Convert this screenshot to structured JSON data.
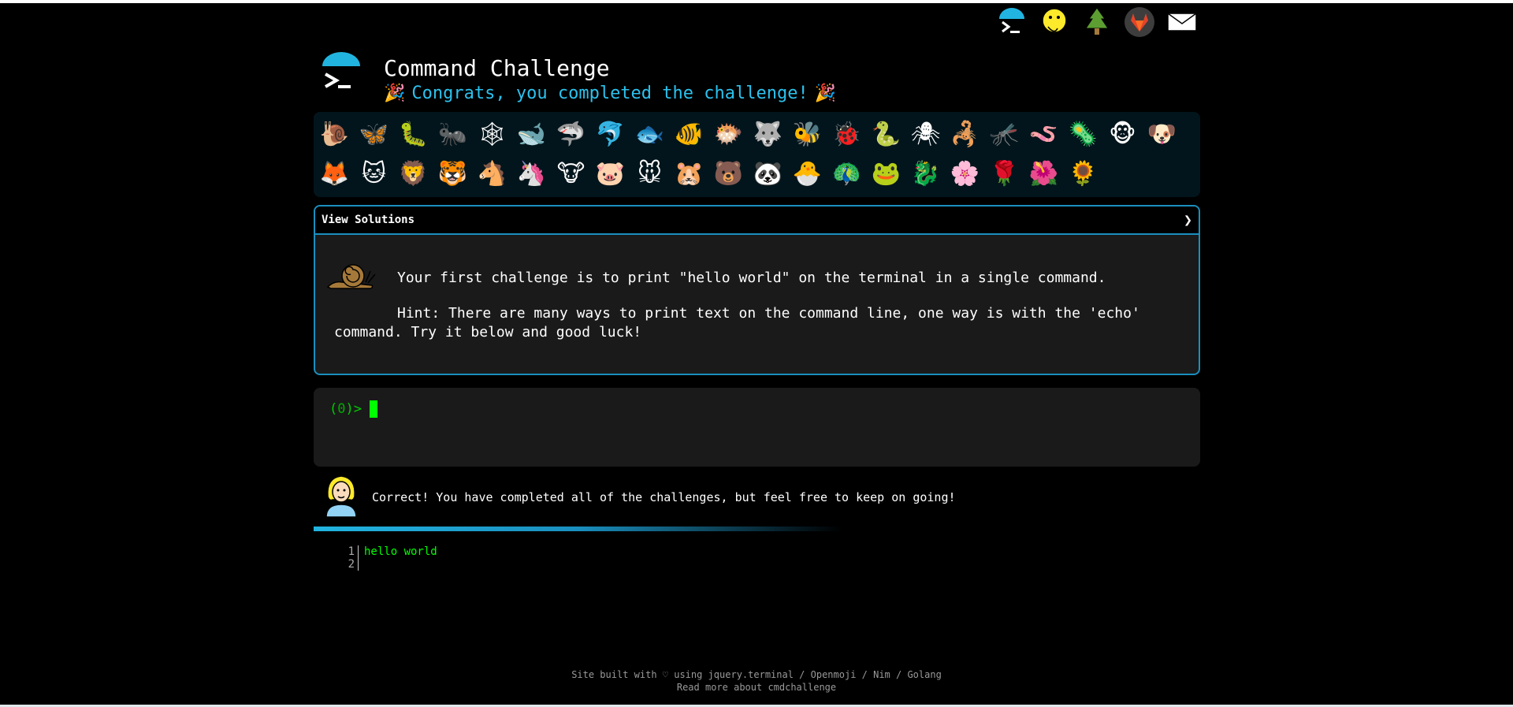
{
  "header": {
    "title": "Command Challenge",
    "subtitle": "Congrats, you completed the challenge!"
  },
  "top_icons": [
    "terminal-icon",
    "face-icon",
    "tree-icon",
    "gitlab-icon",
    "mail-icon"
  ],
  "animals": [
    "🐌",
    "🦋",
    "🐛",
    "🐜",
    "🕸",
    "🐋",
    "🦈",
    "🐬",
    "🐟",
    "🐠",
    "🐡",
    "🐺",
    "🐝",
    "🐞",
    "🐍",
    "🕷",
    "🦂",
    "🦟",
    "🪱",
    "🦠",
    "🐵",
    "🐶",
    "🦊",
    "🐱",
    "🦁",
    "🐯",
    "🐴",
    "🦄",
    "🐮",
    "🐷",
    "🐭",
    "🐹",
    "🐻",
    "🐼",
    "🐣",
    "🦚",
    "🐸",
    "🐉",
    "🌸",
    "🌹",
    "🌺",
    "🌻"
  ],
  "challenge": {
    "header_label": "View Solutions",
    "header_arrow": "❯",
    "text": "Your first challenge is to print \"hello world\" on the terminal in a single command.",
    "hint": "Hint: There are many ways to print text on the command line, one way is with the 'echo' command. Try it below and good luck!"
  },
  "terminal": {
    "prompt_open": "(",
    "prompt_num": "0",
    "prompt_close": ")>"
  },
  "correct_message": "Correct! You have completed all of the challenges, but feel free to keep on going!",
  "output": {
    "lines": [
      {
        "num": "1",
        "text": "hello world"
      },
      {
        "num": "2",
        "text": ""
      }
    ]
  },
  "footer": {
    "line1": "Site built with ♡ using jquery.terminal / Openmoji / Nim / Golang",
    "line2": "Read more about cmdchallenge"
  },
  "colors": {
    "accent": "#2bc2ee",
    "border": "#1a8fbf",
    "terminal_green": "#00ff00"
  }
}
